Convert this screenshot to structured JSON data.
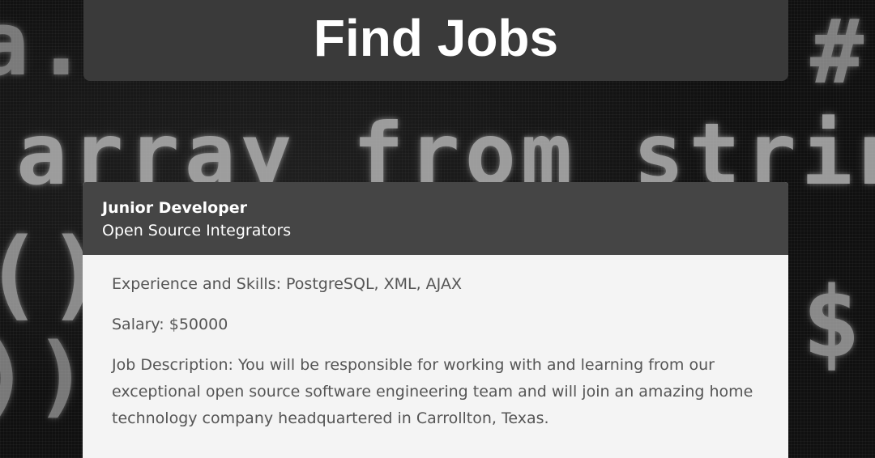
{
  "header": {
    "title": "Find Jobs"
  },
  "background": {
    "code_lines": [
      "a.s",
      "array from string($",
      "()) ",
      "))",
      "#",
      "$(a"
    ]
  },
  "job": {
    "title": "Junior Developer",
    "company": "Open Source Integrators",
    "skills_label": "Experience and Skills:",
    "skills": "PostgreSQL, XML, AJAX",
    "salary_label": "Salary:",
    "salary": "$50000",
    "description_label": "Job Description:",
    "description": "You will be responsible for working with and learning from our exceptional open source software engineering team and will join an amazing home technology company headquartered in Carrollton, Texas."
  },
  "colors": {
    "header_bg": "#3a3a3a",
    "card_header_bg": "#454545",
    "card_body_bg": "#f4f4f4",
    "body_text": "#555555"
  }
}
